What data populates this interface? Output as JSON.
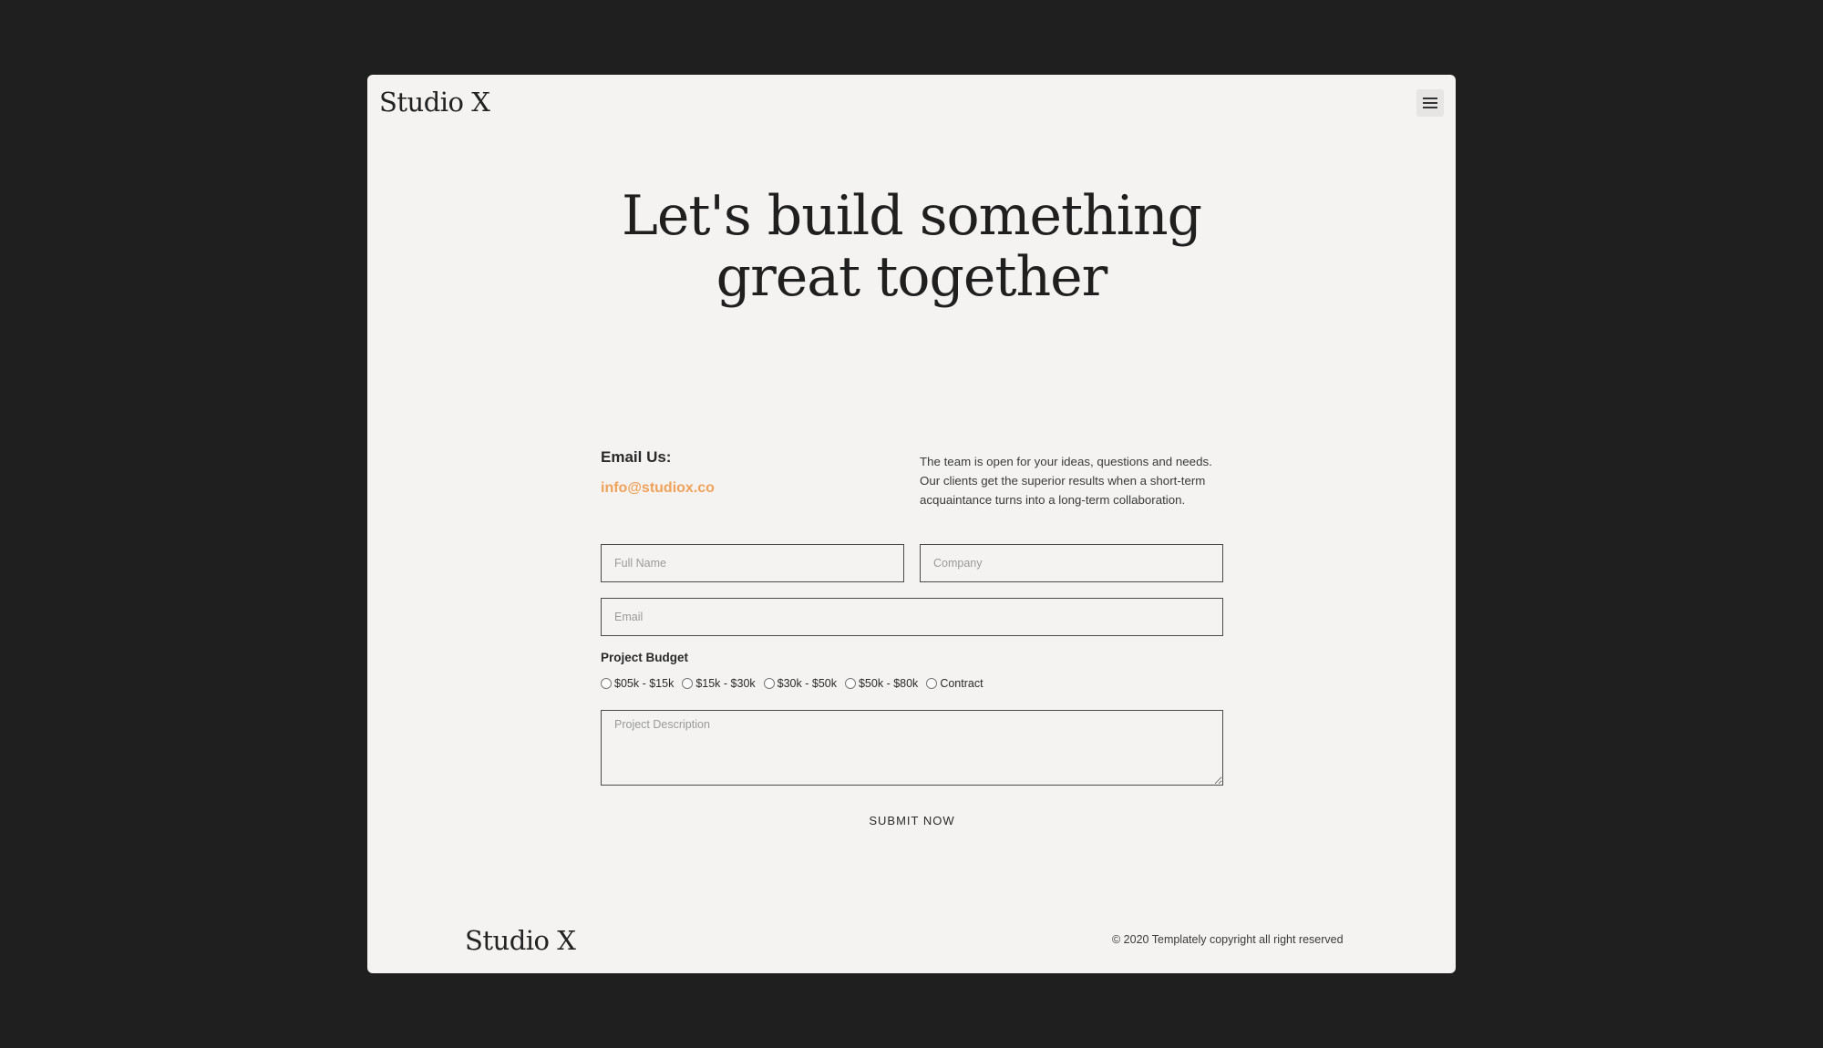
{
  "header": {
    "brand": "Studio X",
    "menu_icon": "hamburger-menu-icon"
  },
  "hero": {
    "line1": "Let's build something",
    "line2": "great together"
  },
  "contact": {
    "email_label": "Email Us:",
    "email": "info@studiox.co",
    "intro": "The team is open for your ideas, questions and needs. Our clients get the superior results when a short-term acquaintance turns into a long-term collaboration."
  },
  "form": {
    "full_name_placeholder": "Full Name",
    "company_placeholder": "Company",
    "email_placeholder": "Email",
    "budget_label": "Project Budget",
    "budget_options": [
      "$05k - $15k",
      "$15k - $30k",
      "$30k - $50k",
      "$50k - $80k",
      "Contract"
    ],
    "description_placeholder": "Project Description",
    "submit_label": "SUBMIT NOW"
  },
  "footer": {
    "brand": "Studio X",
    "copyright": "© 2020 Templately copyright all right reserved"
  },
  "colors": {
    "background": "#201f1f",
    "card": "#f4f3f1",
    "accent": "#f0a25a"
  }
}
